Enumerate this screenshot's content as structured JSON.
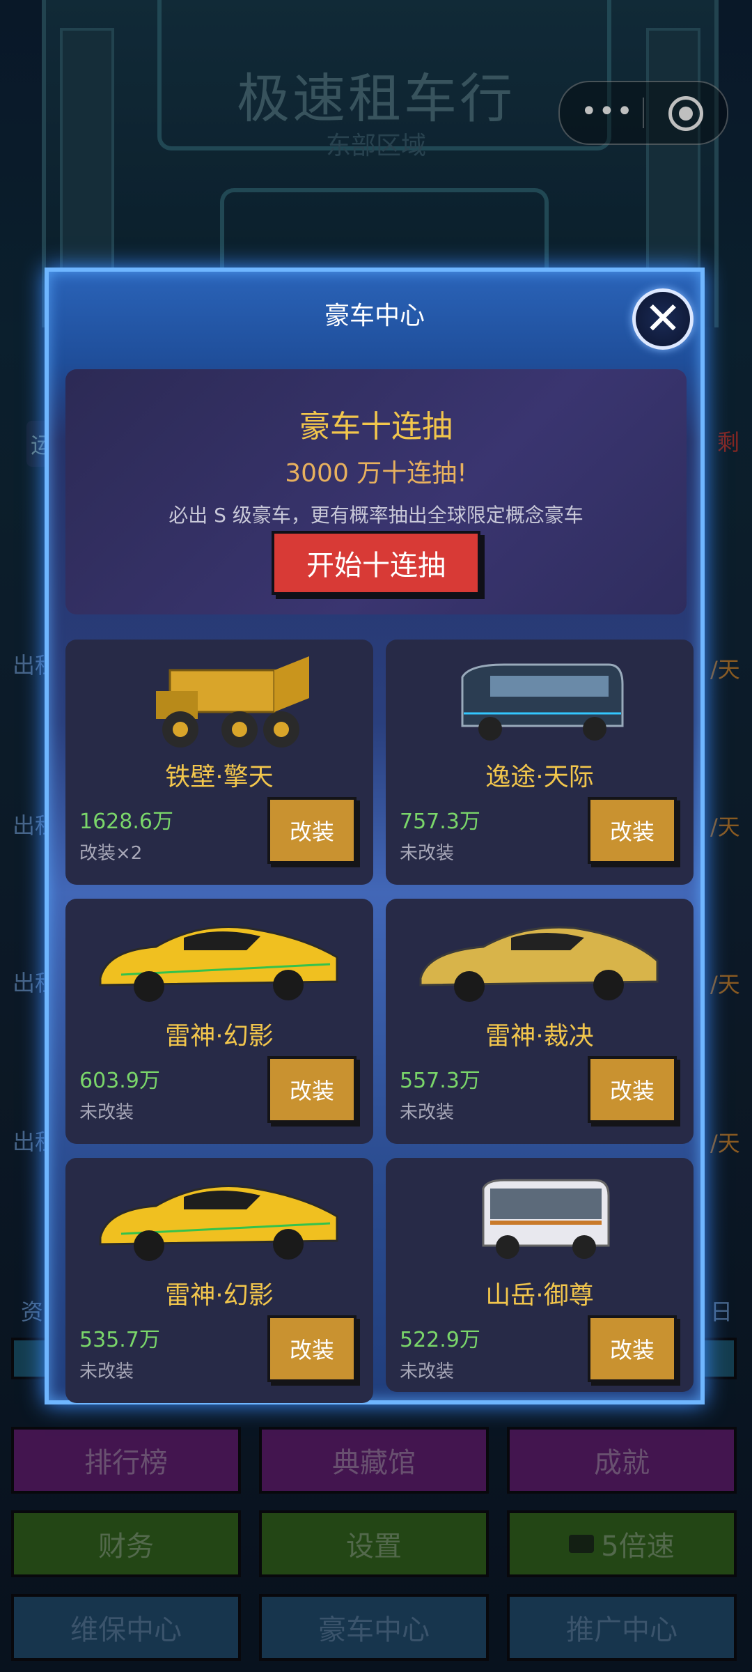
{
  "game": {
    "title": "极速租车行",
    "subtitle": "东部区域"
  },
  "background": {
    "left_labels": [
      "运",
      "出租",
      "出租",
      "出租",
      "出租",
      "资"
    ],
    "right_labels": [
      "剩",
      "/天",
      "/天",
      "/天",
      "/天",
      "日"
    ],
    "buttons": [
      {
        "label": "排行榜",
        "color": "purple"
      },
      {
        "label": "典藏馆",
        "color": "purple"
      },
      {
        "label": "成就",
        "color": "purple"
      },
      {
        "label": "财务",
        "color": "green"
      },
      {
        "label": "设置",
        "color": "green"
      },
      {
        "label": "5倍速",
        "color": "green",
        "icon": "tv-icon"
      },
      {
        "label": "维保中心",
        "color": "blue"
      },
      {
        "label": "豪车中心",
        "color": "blue"
      },
      {
        "label": "推广中心",
        "color": "blue"
      }
    ]
  },
  "modal": {
    "title": "豪车中心",
    "close_icon": "close-icon",
    "banner": {
      "title": "豪车十连抽",
      "subtitle": "3000 万十连抽!",
      "description": "必出 S 级豪车，更有概率抽出全球限定概念豪车",
      "button": "开始十连抽"
    },
    "cars": [
      {
        "name": "铁壁·擎天",
        "price": "1628.6万",
        "status": "改装×2",
        "button": "改装",
        "image": "mining-dump-truck",
        "color": "#d9a52a"
      },
      {
        "name": "逸途·天际",
        "price": "757.3万",
        "status": "未改装",
        "button": "改装",
        "image": "tour-bus",
        "color": "#2b3d52"
      },
      {
        "name": "雷神·幻影",
        "price": "603.9万",
        "status": "未改装",
        "button": "改装",
        "image": "yellow-supercar",
        "color": "#f0c020"
      },
      {
        "name": "雷神·裁决",
        "price": "557.3万",
        "status": "未改装",
        "button": "改装",
        "image": "gold-supercar",
        "color": "#d8b44a"
      },
      {
        "name": "雷神·幻影",
        "price": "535.7万",
        "status": "未改装",
        "button": "改装",
        "image": "yellow-supercar",
        "color": "#f0c020"
      },
      {
        "name": "山岳·御尊",
        "price": "522.9万",
        "status": "未改装",
        "button": "改装",
        "image": "coach-bus",
        "color": "#e8e8ee"
      }
    ]
  }
}
